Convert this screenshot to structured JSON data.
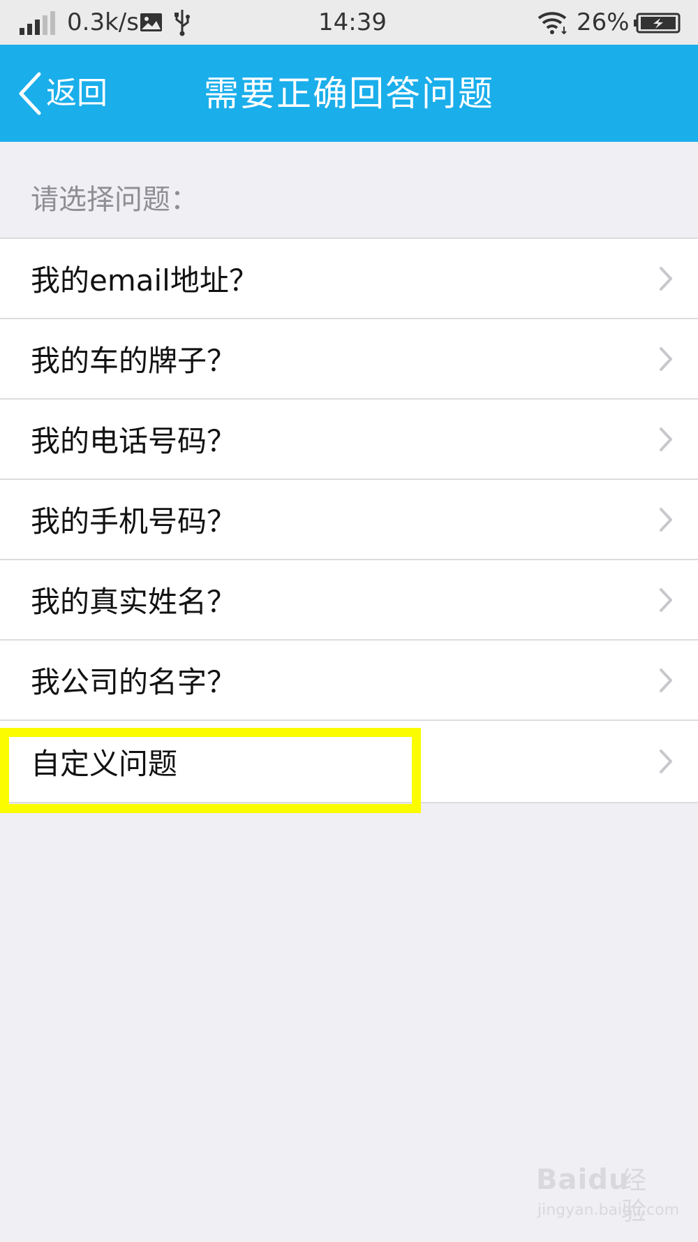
{
  "status_bar": {
    "speed": "0.3k/s",
    "time": "14:39",
    "battery_percent": "26%",
    "icons": [
      "signal-icon",
      "image-icon",
      "usb-icon",
      "wifi-icon",
      "battery-charging-icon"
    ]
  },
  "header": {
    "back_label": "返回",
    "title": "需要正确回答问题",
    "color": "#1aaeeb"
  },
  "section_label": "请选择问题：",
  "questions": [
    {
      "label": "我的email地址？"
    },
    {
      "label": "我的车的牌子？"
    },
    {
      "label": "我的电话号码？"
    },
    {
      "label": "我的手机号码？"
    },
    {
      "label": "我的真实姓名？"
    },
    {
      "label": "我公司的名字？"
    },
    {
      "label": "自定义问题"
    }
  ],
  "highlight_color": "#fcfc00",
  "watermark": {
    "logo": "Baidu",
    "logo_cn": "经验",
    "url": "jingyan.baidu.com"
  }
}
